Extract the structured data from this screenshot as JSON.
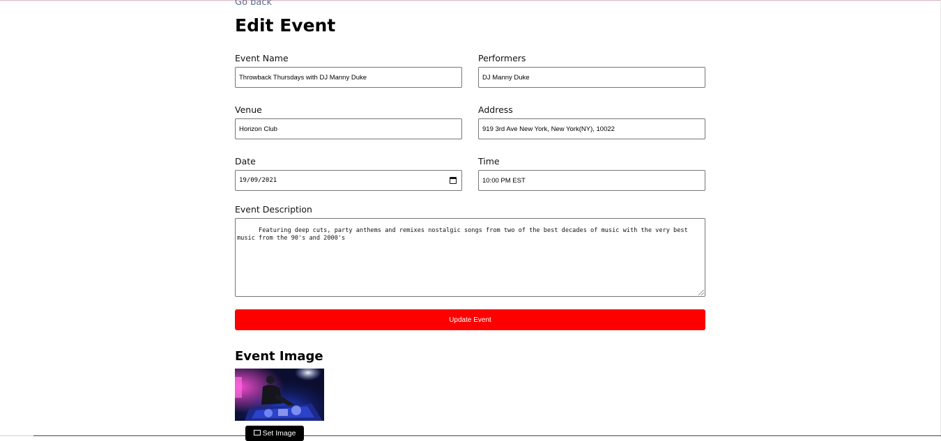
{
  "nav": {
    "go_back": "Go back"
  },
  "page": {
    "title": "Edit Event"
  },
  "form": {
    "event_name": {
      "label": "Event Name",
      "value": "Throwback Thursdays with DJ Manny Duke"
    },
    "performers": {
      "label": "Performers",
      "value": "DJ Manny Duke"
    },
    "venue": {
      "label": "Venue",
      "value": "Horizon Club"
    },
    "address": {
      "label": "Address",
      "value": "919 3rd Ave New York, New York(NY), 10022"
    },
    "date": {
      "label": "Date",
      "value": "19/09/2021",
      "icon": "calendar-icon"
    },
    "time": {
      "label": "Time",
      "value": "10:00 PM EST"
    },
    "description": {
      "label": "Event Description",
      "value": "Featuring deep cuts, party anthems and remixes nostalgic songs from two of the best decades of music with the very best\nmusic from the 90's and 2000's"
    },
    "submit_label": "Update Event"
  },
  "image_section": {
    "title": "Event Image",
    "set_image_label": "Set Image",
    "set_image_icon": "image-icon"
  },
  "colors": {
    "accent": "#ff0000",
    "link": "#5b6b8c",
    "button_dark": "#000000"
  }
}
